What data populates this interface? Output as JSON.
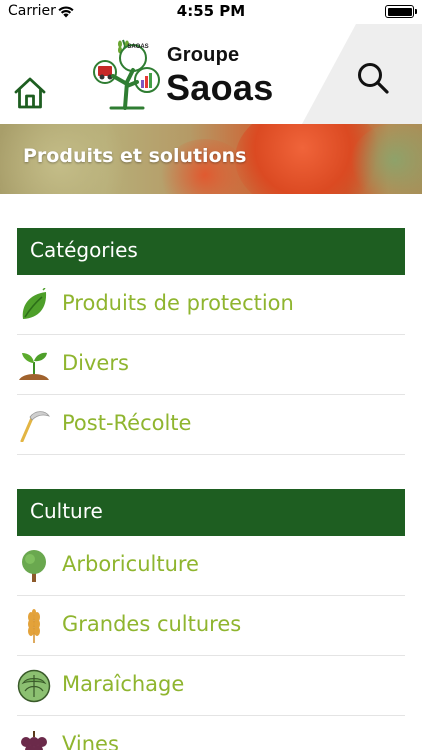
{
  "status_bar": {
    "carrier": "Carrier",
    "time": "4:55 PM"
  },
  "header": {
    "brand_line1": "Groupe",
    "brand_line2": "Saoas",
    "logo_tree_text": "SAOAS"
  },
  "banner": {
    "title": "Produits et solutions"
  },
  "sections": [
    {
      "title": "Catégories",
      "items": [
        {
          "label": "Produits de protection",
          "icon": "leaf-icon"
        },
        {
          "label": "Divers",
          "icon": "seedling-icon"
        },
        {
          "label": "Post-Récolte",
          "icon": "scythe-icon"
        }
      ]
    },
    {
      "title": "Culture",
      "items": [
        {
          "label": "Arboriculture",
          "icon": "tree-icon"
        },
        {
          "label": "Grandes cultures",
          "icon": "wheat-icon"
        },
        {
          "label": "Maraîchage",
          "icon": "cabbage-icon"
        },
        {
          "label": "Vines",
          "icon": "grapes-icon"
        }
      ]
    }
  ],
  "colors": {
    "section_header": "#1e5e21",
    "item_text": "#8fb52f",
    "home_icon": "#1e5e21"
  }
}
